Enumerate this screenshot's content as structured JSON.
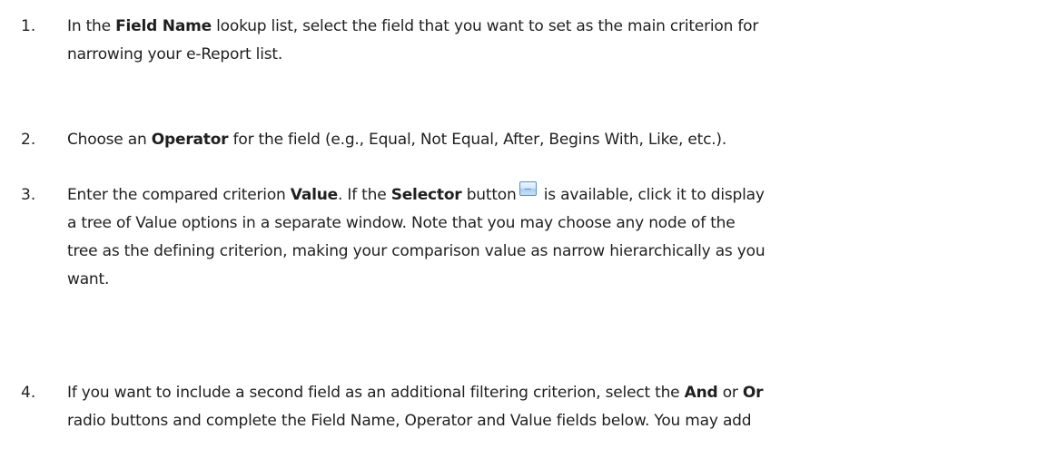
{
  "steps": [
    {
      "number": "1.",
      "lines": [
        {
          "pre": "In the ",
          "bold": "Field Name",
          "post": " lookup list, select the field that you want to set as the main criterion for"
        },
        {
          "text": "narrowing your e-Report list."
        }
      ]
    },
    {
      "number": "2.",
      "lines": [
        {
          "pre": "Choose an ",
          "bold": "Operator",
          "post": " for the field (e.g., Equal, Not Equal, After, Begins With, Like, etc.)."
        }
      ]
    },
    {
      "number": "3.",
      "lines": [
        {
          "pre": "Enter the compared criterion ",
          "bold": "Value",
          "mid": ". If the ",
          "bold2": "Selector",
          "mid2": " button",
          "post": " is available, click it to display"
        },
        {
          "text": "a tree of Value options in a separate window. Note that you may choose any node of the"
        },
        {
          "text": "tree as the defining criterion, making your comparison value as narrow hierarchically as you"
        },
        {
          "text": "want."
        }
      ]
    },
    {
      "number": "4.",
      "lines": [
        {
          "pre": "If you want to include a second field as an additional filtering criterion, select the ",
          "bold": "And",
          "mid": " or ",
          "bold2": "Or"
        },
        {
          "text": "radio buttons and complete the Field Name, Operator and Value fields below. You may add"
        }
      ]
    }
  ],
  "selector_button": {
    "icon": "ellipsis-icon",
    "label": "..."
  }
}
